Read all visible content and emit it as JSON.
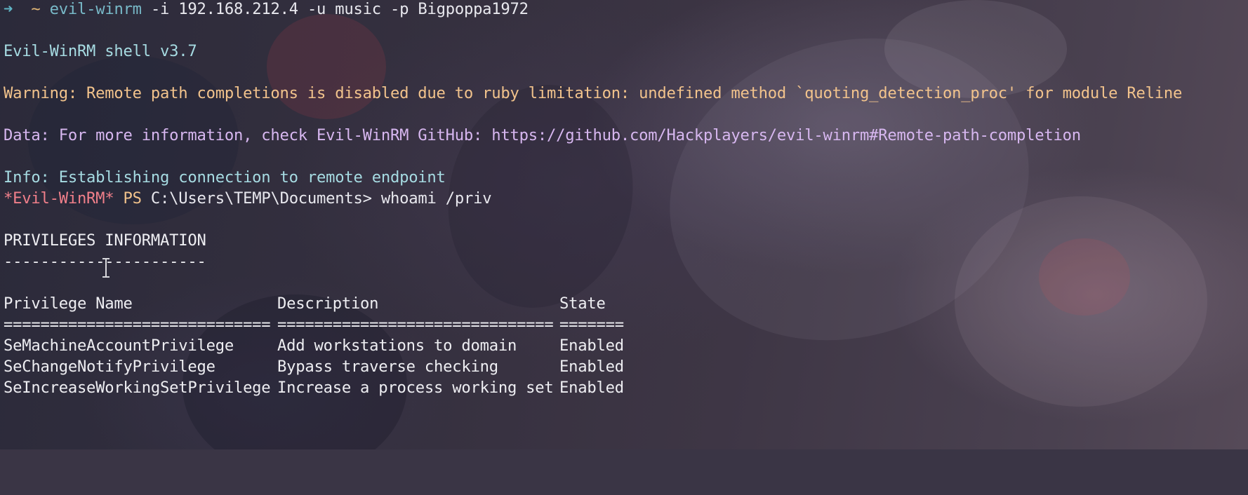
{
  "command_line": {
    "arrow": "➜",
    "cwd": "~",
    "command": "evil-winrm",
    "args": "-i 192.168.212.4 -u music -p Bigpoppa1972"
  },
  "banner": "Evil-WinRM shell v3.7",
  "warning": "Warning: Remote path completions is disabled due to ruby limitation: undefined method `quoting_detection_proc' for module Reline",
  "data_message": "Data: For more information, check Evil-WinRM GitHub: https://github.com/Hackplayers/evil-winrm#Remote-path-completion",
  "info_message": "Info: Establishing connection to remote endpoint",
  "prompt": {
    "shell_tag": "*Evil-WinRM*",
    "ps": "PS",
    "path": "C:\\Users\\TEMP\\Documents>",
    "command": "whoami /priv"
  },
  "privileges": {
    "title": "PRIVILEGES INFORMATION",
    "title_underline": "----------------------",
    "headers": [
      "Privilege Name",
      "Description",
      "State"
    ],
    "separators": [
      "=============================",
      "==============================",
      "======="
    ],
    "rows": [
      {
        "name": "SeMachineAccountPrivilege",
        "description": "Add workstations to domain",
        "state": "Enabled"
      },
      {
        "name": "SeChangeNotifyPrivilege",
        "description": "Bypass traverse checking",
        "state": "Enabled"
      },
      {
        "name": "SeIncreaseWorkingSetPrivilege",
        "description": "Increase a process working set",
        "state": "Enabled"
      }
    ]
  },
  "colors": {
    "warning": "#f2c38c",
    "data": "#d7b7f0",
    "info": "#a6dbe2",
    "prompt_tag": "#f07f8a"
  }
}
